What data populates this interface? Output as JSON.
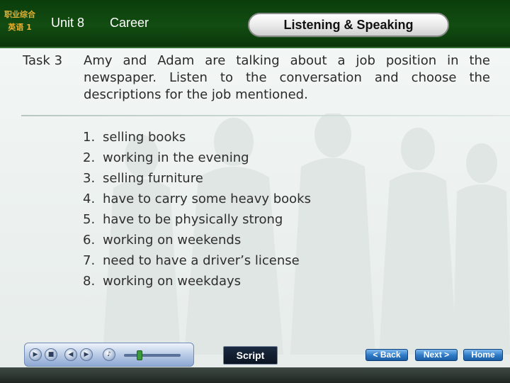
{
  "header": {
    "logo_line1": "职业综合",
    "logo_line2": "英语 1",
    "unit": "Unit 8",
    "topic": "Career",
    "section": "Listening & Speaking"
  },
  "task": {
    "label": "Task 3",
    "instruction": "Amy and Adam are talking about a job position in the newspaper. Listen to the conversation and choose the descriptions for the job mentioned."
  },
  "options": [
    {
      "num": "1.",
      "text": "selling books"
    },
    {
      "num": "2.",
      "text": "working in the evening"
    },
    {
      "num": "3.",
      "text": "selling furniture"
    },
    {
      "num": "4.",
      "text": "have to carry some heavy books"
    },
    {
      "num": "5.",
      "text": "have to be physically strong"
    },
    {
      "num": "6.",
      "text": "working on weekends"
    },
    {
      "num": "7.",
      "text": "need to have a driver’s license"
    },
    {
      "num": "8.",
      "text": "working on weekdays"
    }
  ],
  "player": {
    "play_icon": "play-icon",
    "stop_icon": "stop-icon",
    "prev_icon": "previous-icon",
    "next_icon": "next-track-icon",
    "volume_icon": "speaker-icon"
  },
  "buttons": {
    "script": "Script",
    "back": "< Back",
    "next": "Next >",
    "home": "Home"
  },
  "colors": {
    "header_green": "#0b3d0b",
    "accent_gold": "#e8b030",
    "nav_blue": "#2d78c4"
  }
}
